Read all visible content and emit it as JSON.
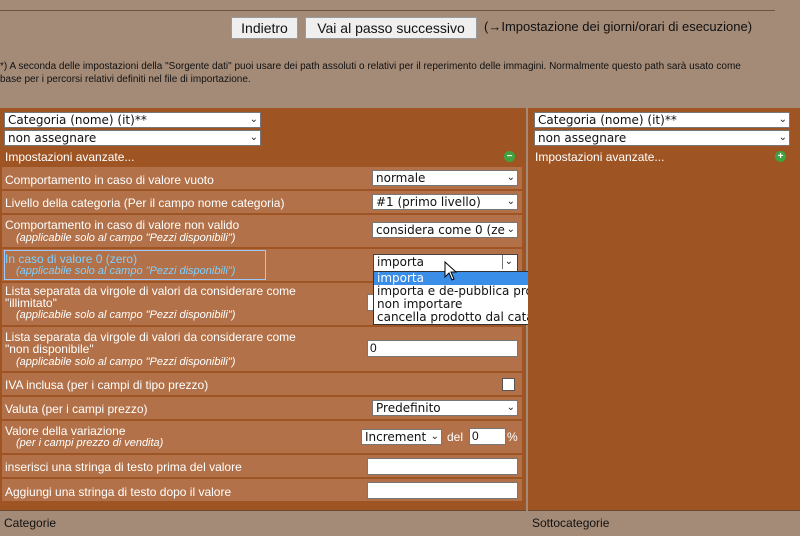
{
  "toolbar": {
    "back_label": "Indietro",
    "next_label": "Vai al passo successivo",
    "next_hint": "(→Impostazione dei giorni/orari di esecuzione)"
  },
  "note": {
    "line1": "*) A seconda delle impostazioni della \"Sorgente dati\" puoi usare dei path assoluti o relativi per il reperimento delle immagini. Normalmente questo path sarà usato come",
    "line2": "base per i percorsi relativi definiti nel file di importazione."
  },
  "left": {
    "field_select": "Categoria (nome) (it)**",
    "assign_select": "non assegnare",
    "advanced_label": "Impostazioni avanzate...",
    "rows": [
      {
        "label": "Comportamento in caso di valore vuoto",
        "value": "normale"
      },
      {
        "label": "Livello della categoria (Per il campo nome categoria)",
        "value": "#1 (primo livello)"
      },
      {
        "label": "Comportamento in caso di valore non valido",
        "sub": "(applicabile solo al campo \"Pezzi disponibili\")",
        "value": "considera come 0 (ze"
      },
      {
        "label": "In caso di valore 0 (zero)",
        "sub": "(applicabile solo al campo \"Pezzi disponibili\")",
        "value": "importa"
      },
      {
        "label": "Lista separata da virgole di valori da considerare come",
        "label2": "\"illimitato\"",
        "sub": "(applicabile solo al campo \"Pezzi disponibili\")"
      },
      {
        "label": "Lista separata da virgole di valori da considerare come",
        "label2": "\"non disponibile\"",
        "sub": "(applicabile solo al campo \"Pezzi disponibili\")",
        "value": "0"
      },
      {
        "label": "IVA inclusa (per i campi di tipo prezzo)"
      },
      {
        "label": "Valuta (per i campi prezzo)",
        "value": "Predefinito"
      },
      {
        "label": "Valore della variazione",
        "sub": "(per i campi prezzo di vendita)",
        "value": "Increment",
        "del_label": "del",
        "amount": "0",
        "pct": "%"
      },
      {
        "label": "inserisci una stringa di testo prima del valore"
      },
      {
        "label": "Aggiungi una stringa di testo dopo il valore"
      }
    ],
    "dropdown_options": [
      "importa",
      "importa e de-pubblica prodotto",
      "non importare",
      "cancella prodotto dal catalogo"
    ],
    "footer": "Categorie"
  },
  "right": {
    "field_select": "Categoria (nome) (it)**",
    "assign_select": "non assegnare",
    "advanced_label": "Impostazioni avanzate...",
    "footer": "Sottocategorie"
  },
  "colors": {
    "panel": "#9e5423",
    "row": "#b27148",
    "highlight": "#3b8ee8",
    "link": "#7fd0ff"
  }
}
